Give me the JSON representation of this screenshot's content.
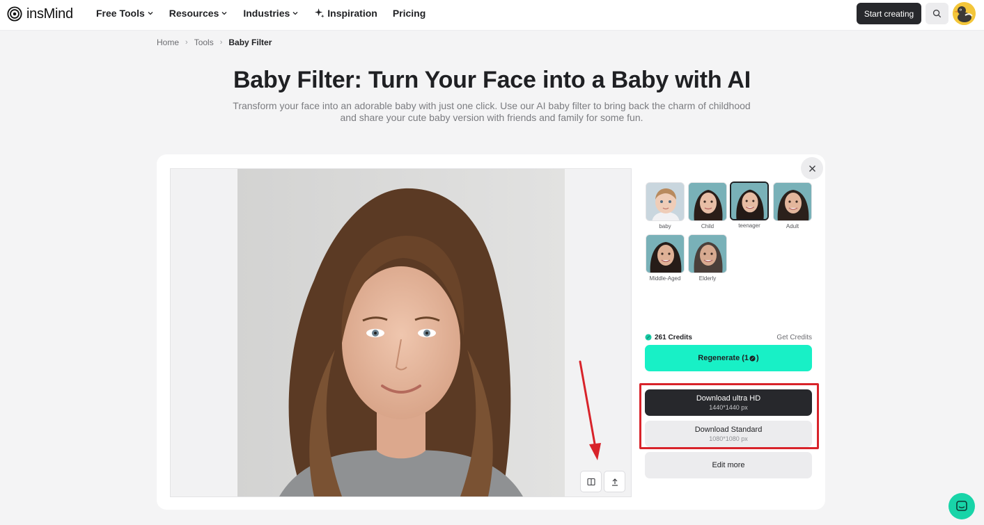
{
  "brand": {
    "name": "insMind"
  },
  "nav": {
    "items": [
      {
        "label": "Free Tools",
        "dropdown": true
      },
      {
        "label": "Resources",
        "dropdown": true
      },
      {
        "label": "Industries",
        "dropdown": true
      },
      {
        "label": "Inspiration",
        "icon": "sparkle-icon"
      },
      {
        "label": "Pricing"
      }
    ],
    "start_label": "Start creating",
    "search_icon": "search-icon"
  },
  "breadcrumb": {
    "home": "Home",
    "tools": "Tools",
    "current": "Baby Filter"
  },
  "hero": {
    "title": "Baby Filter: Turn Your Face into a Baby with AI",
    "subtitle": "Transform your face into an adorable baby with just one click. Use our AI baby filter to bring back the charm of childhood and share your cute baby version with friends and family for some fun."
  },
  "styles": {
    "options": [
      {
        "label": "baby",
        "selected": false
      },
      {
        "label": "Child",
        "selected": false
      },
      {
        "label": "teenager",
        "selected": true
      },
      {
        "label": "Adult",
        "selected": false
      },
      {
        "label": "Middle-Aged",
        "selected": false
      },
      {
        "label": "Elderly",
        "selected": false
      }
    ]
  },
  "credits": {
    "amount": "261 Credits",
    "get_label": "Get Credits"
  },
  "actions": {
    "regenerate": "Regenerate (1 ",
    "regenerate_suffix": ")",
    "download_hd": "Download ultra HD",
    "download_hd_size": "1440*1440 px",
    "download_std": "Download Standard",
    "download_std_size": "1080*1080 px",
    "edit_more": "Edit more"
  },
  "colors": {
    "accent": "#18f0c6",
    "dark_button": "#27282c",
    "highlight": "#d8232a",
    "chat": "#18d4a8"
  }
}
